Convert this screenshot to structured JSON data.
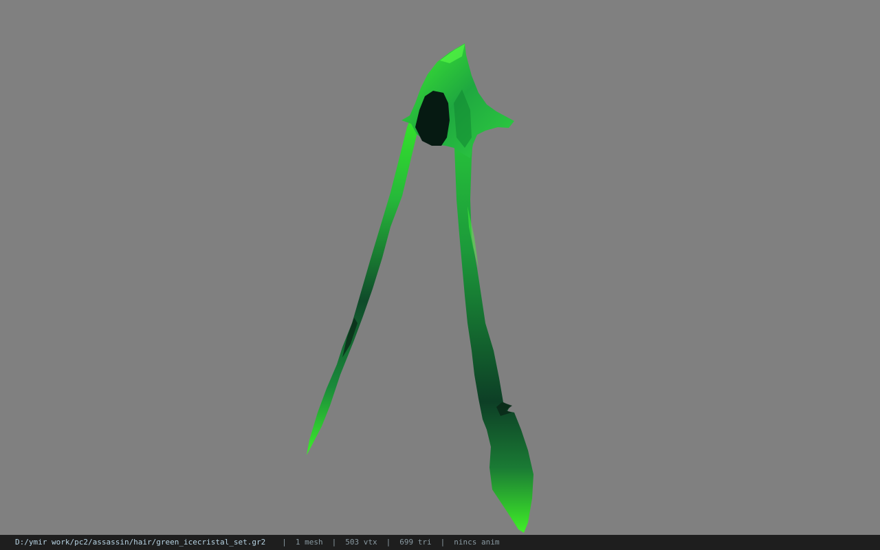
{
  "viewer": {
    "background_color": "#808080",
    "model_colors": {
      "bright": "#35e62a",
      "mid": "#1c9a3a",
      "dark": "#0b3a22",
      "inner": "#061a12"
    }
  },
  "status_bar": {
    "file_path": "D:/ymir work/pc2/assassin/hair/green_icecristal_set.gr2",
    "separator": "|",
    "mesh_count": "1 mesh",
    "vertex_count": "503 vtx",
    "triangle_count": "699 tri",
    "anim_status": "nincs anim"
  }
}
